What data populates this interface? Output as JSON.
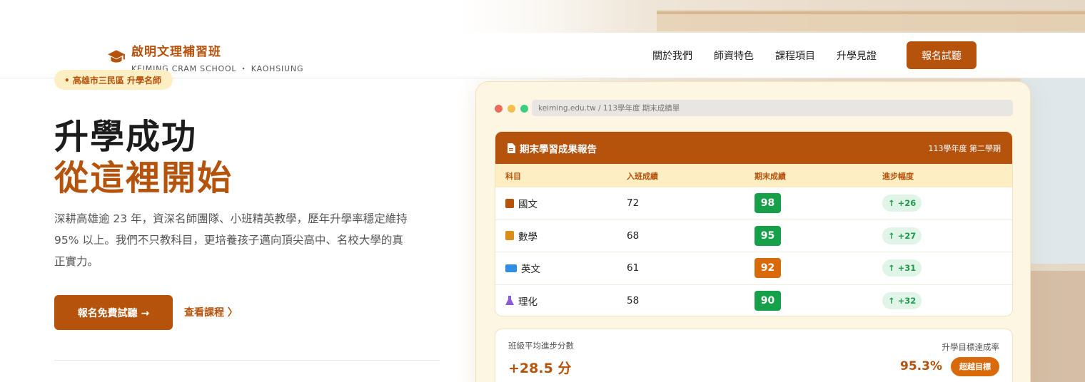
{
  "brand": {
    "name": "啟明文理補習班",
    "subtitle": "KEIMING CRAM SCHOOL ・ KAOHSIUNG",
    "accent": "#b5520c"
  },
  "nav": {
    "items": [
      "關於我們",
      "師資特色",
      "課程項目",
      "升學見證"
    ],
    "cta": "報名試聽"
  },
  "hero": {
    "tag": "• 高雄市三民區 升學名師",
    "title_line1": "升學成功",
    "title_line2": "從這裡開始",
    "description": "深耕高雄逾 23 年，資深名師團隊、小班精英教學，歷年升學率穩定維持 95% 以上。我們不只教科目，更培養孩子邁向頂尖高中、名校大學的真正實力。",
    "primary_button": "報名免費試聽 →",
    "link_button": "查看課程 〉"
  },
  "report_card": {
    "url": "keiming.edu.tw / 113學年度 期末成績單",
    "title": "期末學習成果報告",
    "term": "113學年度 第二學期",
    "columns": [
      "科目",
      "入班成績",
      "期末成績",
      "進步幅度"
    ],
    "rows": [
      {
        "subject": "國文",
        "icon": "book-icon",
        "entry": "72",
        "final": "98",
        "final_color": "#17a04a",
        "improve": "↑ +26"
      },
      {
        "subject": "數學",
        "icon": "calculator-icon",
        "entry": "68",
        "final": "95",
        "final_color": "#17a04a",
        "improve": "↑ +27"
      },
      {
        "subject": "英文",
        "icon": "translate-icon",
        "entry": "61",
        "final": "92",
        "final_color": "#d96a0b",
        "improve": "↑ +31"
      },
      {
        "subject": "理化",
        "icon": "flask-icon",
        "entry": "58",
        "final": "90",
        "final_color": "#17a04a",
        "improve": "↑ +32"
      }
    ],
    "summary": {
      "avg_label": "班級平均進步分數",
      "avg_value": "+28.5 分",
      "rate_label": "升學目標達成率",
      "rate_value": "95.3%",
      "badge": "超越目標"
    }
  }
}
